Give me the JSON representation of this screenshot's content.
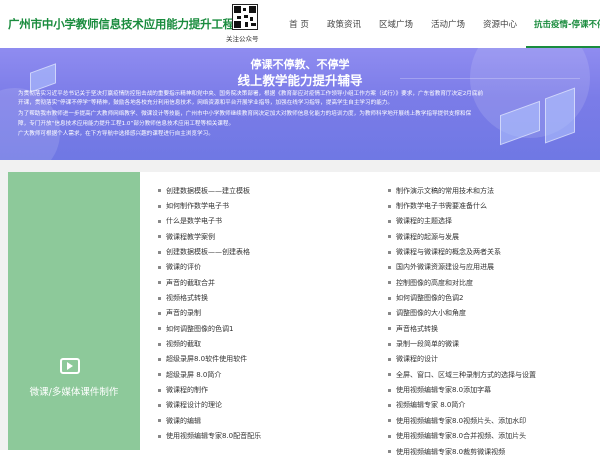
{
  "header": {
    "site_title": "广州市中小学教师信息技术应用能力提升工程",
    "qr_label": "关注公众号"
  },
  "nav": [
    {
      "label": "首 页",
      "active": false
    },
    {
      "label": "政策资讯",
      "active": false
    },
    {
      "label": "区域广场",
      "active": false
    },
    {
      "label": "活动广场",
      "active": false
    },
    {
      "label": "资源中心",
      "active": false
    },
    {
      "label": "抗击疫情-停课不停学",
      "active": true
    }
  ],
  "banner": {
    "title1": "停课不停教、不停学",
    "title2": "线上教学能力提升辅导",
    "paragraphs": [
      "为贯彻落实习近平总书记关于坚决打赢疫情防控阻击战的重要指示精神和党中央、国务院决策部署，根据《教育部应对疫情工作领导小组工作方案（试行）》要求，广东省教育厅决定2月底前",
      "开课，贯彻落实“停课不停学”等精神，鼓励各地各校充分利用信息技术，网络资源和平台开展学业指导，加强在线学习指导，提高学生自主学习的能力。",
      "为了帮助我市教师进一步提高广大教师网络教学、微课设计等技能，广州市中小学教师继续教育网决定加大对教师信息化能力的培训力度，为教师科学地开展线上教学指导提供支撑和保",
      "障，专门开放“信息技术应用能力提升工程1.0”部分教师信息技术应用工程等相关课程。",
      "广大教师可根据个人需求，在下方导航中选择感兴趣的课程进行自主浏览学习。"
    ]
  },
  "category": {
    "label": "微课/多媒体课件制作",
    "icon": "video-play-icon"
  },
  "courses_left": [
    "创建数据模板——建立模板",
    "如何制作数学电子书",
    "什么是数学电子书",
    "微课程教学案例",
    "创建数据模板——创建表格",
    "微课的评价",
    "声音的截取合并",
    "视频格式转换",
    "声音的录制",
    "如何调整图像的色调1",
    "视频的截取",
    "超级录屏8.0软件使用软件",
    "超级录屏 8.0简介",
    "微课程的制作",
    "微课程设计的理论",
    "微课的编辑",
    "使用视频编辑专家8.0配音配乐"
  ],
  "courses_right": [
    "制作演示文稿的常用技术和方法",
    "制作数学电子书需要准备什么",
    "微课程的主题选择",
    "微课程的起源与发展",
    "微课程与微课程的概念及两者关系",
    "国内外微课资源建设与应用进展",
    "控制图像的高度和对比度",
    "如何调整图像的色调2",
    "调整图像的大小和角度",
    "声音格式转换",
    "录制一段简单的微课",
    "微课程的设计",
    "全屏、窗口、区域三种录制方式的选择与设置",
    "使用视频编辑专家8.0添加字幕",
    "视频编辑专家 8.0简介",
    "使用视频编辑专家8.0视频片头、添加水印",
    "使用视频编辑专家8.0合并视频、添加片头",
    "使用视频编辑专家8.0裁剪微课视频"
  ],
  "colors": {
    "brand_green": "#1a8c3e",
    "banner_purple": "#7b7ce8",
    "category_green": "#8dc99a"
  }
}
